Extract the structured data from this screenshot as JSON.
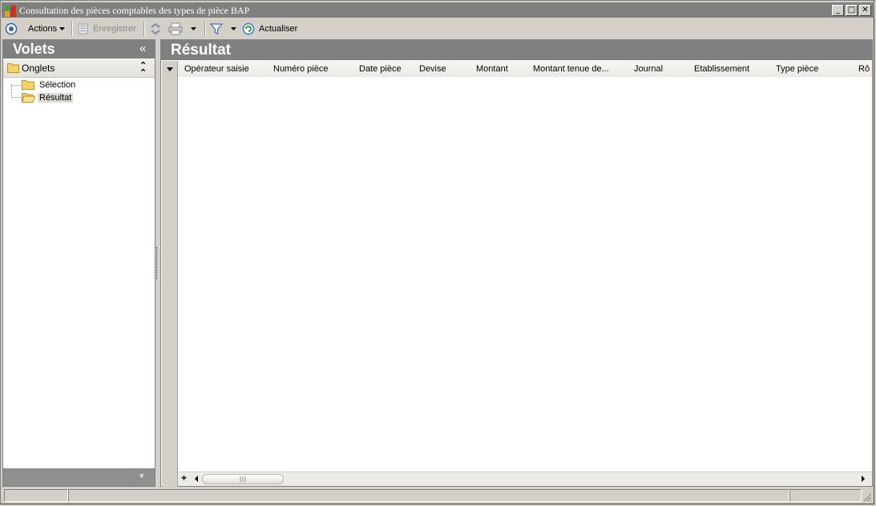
{
  "window": {
    "title": "Consultation des pièces comptables des types de pièce BAP",
    "minimize": "_",
    "maximize": "□",
    "close": "✕"
  },
  "toolbar": {
    "actions_label": "Actions",
    "save_label": "Enregistrer",
    "refresh_label": "Actualiser"
  },
  "left_pane": {
    "title": "Volets",
    "collapse_glyph": "«",
    "section_title": "Onglets",
    "section_glyph": "⌃",
    "tree": [
      {
        "label": "Sélection",
        "selected": false
      },
      {
        "label": "Résultat",
        "selected": true
      }
    ],
    "footer_glyph": "▾"
  },
  "right_pane": {
    "title": "Résultat",
    "columns": [
      "Opérateur saisie",
      "Numéro pièce",
      "Date pièce",
      "Devise",
      "Montant",
      "Montant tenue de...",
      "Journal",
      "Etablissement",
      "Type pièce",
      "Rô"
    ],
    "add_glyph": "+"
  },
  "colors": {
    "header_bg": "#808080",
    "chrome_bg": "#d4d0c8",
    "selected_bg": "#dedcd4"
  }
}
